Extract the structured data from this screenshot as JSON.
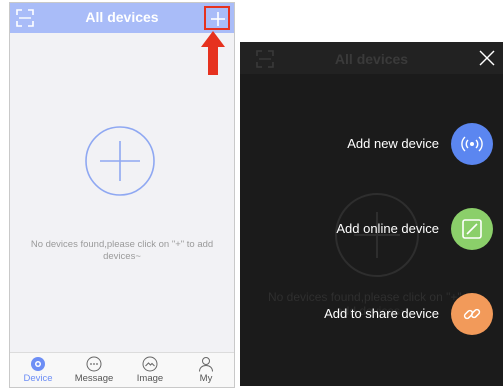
{
  "left_screen": {
    "header": {
      "title": "All devices",
      "scan_icon": "scan-icon",
      "add_icon": "plus-icon"
    },
    "empty_state": {
      "message": "No devices found,please click on \"+\" to add devices~"
    },
    "tabs": [
      {
        "label": "Device",
        "icon": "camera-icon",
        "active": true
      },
      {
        "label": "Message",
        "icon": "chat-bubble-icon",
        "active": false
      },
      {
        "label": "Image",
        "icon": "image-icon",
        "active": false
      },
      {
        "label": "My",
        "icon": "user-icon",
        "active": false
      }
    ],
    "colors": {
      "header": "#a9bcf8",
      "accent": "#6d8ef5",
      "highlight": "#e6321f"
    }
  },
  "right_screen": {
    "header": {
      "title": "All devices"
    },
    "empty_state": {
      "message": "No devices found,please click on \"+\" to add devices~"
    },
    "menu": [
      {
        "label": "Add new device",
        "icon": "wireless-signal-icon",
        "color": "#5b86f0"
      },
      {
        "label": "Add online device",
        "icon": "edit-square-icon",
        "color": "#8bcf6a"
      },
      {
        "label": "Add to share device",
        "icon": "link-icon",
        "color": "#f29a5a"
      }
    ]
  }
}
